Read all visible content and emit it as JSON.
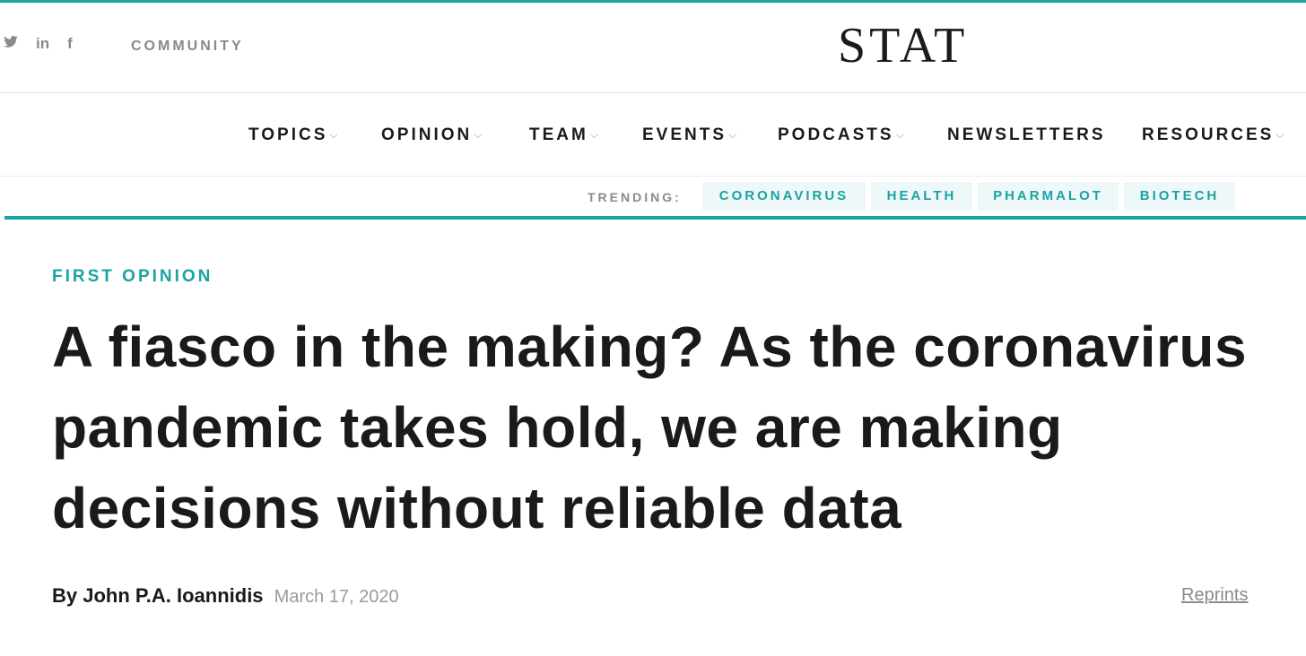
{
  "header": {
    "social": [
      {
        "icon": "twitter-icon",
        "glyph": "🐦"
      },
      {
        "icon": "linkedin-icon",
        "glyph": "in"
      },
      {
        "icon": "facebook-icon",
        "glyph": "f"
      }
    ],
    "community_label": "COMMUNITY",
    "logo": "STAT"
  },
  "nav": {
    "items": [
      {
        "label": "TOPICS",
        "dropdown": true
      },
      {
        "label": "OPINION",
        "dropdown": true
      },
      {
        "label": "TEAM",
        "dropdown": true
      },
      {
        "label": "EVENTS",
        "dropdown": true
      },
      {
        "label": "PODCASTS",
        "dropdown": true
      },
      {
        "label": "NEWSLETTERS",
        "dropdown": false
      },
      {
        "label": "RESOURCES",
        "dropdown": true
      }
    ],
    "chevron": "⌵"
  },
  "trending": {
    "label": "TRENDING:",
    "tags": [
      "CORONAVIRUS",
      "HEALTH",
      "PHARMALOT",
      "BIOTECH"
    ]
  },
  "article": {
    "kicker": "FIRST OPINION",
    "headline": "A fiasco in the making? As the coronavirus pandemic takes hold, we are making decisions without reliable data",
    "by": "By",
    "author": "John P.A. Ioannidis",
    "date": "March 17, 2020",
    "reprints": "Reprints"
  },
  "colors": {
    "accent": "#1aa3a3",
    "pill_bg": "#eef8f9",
    "text": "#1a1a1a",
    "muted": "#8a8a8a"
  }
}
